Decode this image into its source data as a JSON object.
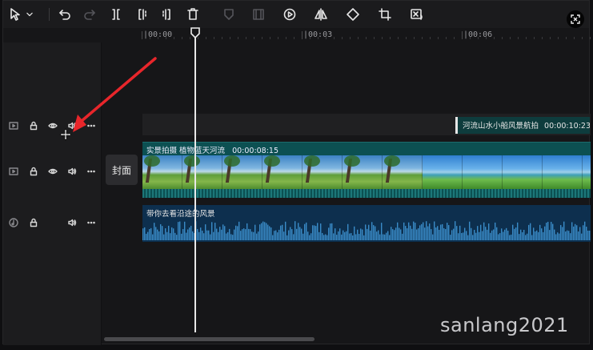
{
  "toolbar": {
    "tools": [
      {
        "name": "select-tool",
        "icon": "cursor-icon"
      },
      {
        "name": "undo",
        "icon": "undo-icon"
      },
      {
        "name": "redo",
        "icon": "redo-icon",
        "disabled": true
      },
      {
        "name": "split",
        "icon": "split-icon"
      },
      {
        "name": "split-left",
        "icon": "split-left-icon"
      },
      {
        "name": "split-right",
        "icon": "split-right-icon"
      },
      {
        "name": "delete",
        "icon": "trash-icon"
      },
      {
        "name": "marker",
        "icon": "shield-icon",
        "disabled": true
      },
      {
        "name": "freeze-frame",
        "icon": "freeze-icon",
        "disabled": true
      },
      {
        "name": "play-speed",
        "icon": "play-circle-icon"
      },
      {
        "name": "mirror",
        "icon": "mirror-icon"
      },
      {
        "name": "rotate",
        "icon": "rotate-icon"
      },
      {
        "name": "crop",
        "icon": "crop-icon"
      },
      {
        "name": "smart-crop",
        "icon": "smart-crop-icon"
      }
    ]
  },
  "ruler": {
    "labels": [
      "|00:00",
      "|00:03",
      "|00:06"
    ]
  },
  "tracks": {
    "cover_label": "封面",
    "text_clip": {
      "label": "河流山水小船风景航拍",
      "duration": "00:00:10:23"
    },
    "video_clip": {
      "label": "实景拍摄 植物蓝天河流",
      "duration": "00:00:08:15"
    },
    "audio_clip": {
      "label": "带你去看沿途的风景"
    }
  },
  "watermark": "sanlang2021",
  "colors": {
    "text_clip": "#0e3c3d",
    "video_clip": "#0c5052",
    "audio_clip": "#0d2f4e",
    "annotation_arrow": "#e8262b"
  }
}
